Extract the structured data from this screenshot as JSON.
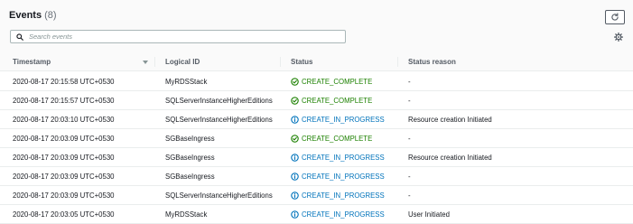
{
  "header": {
    "title": "Events",
    "count": "(8)"
  },
  "search": {
    "placeholder": "Search events",
    "value": ""
  },
  "columns": {
    "timestamp": "Timestamp",
    "logical_id": "Logical ID",
    "status": "Status",
    "status_reason": "Status reason"
  },
  "status_colors": {
    "CREATE_COMPLETE": "#1d8102",
    "CREATE_IN_PROGRESS": "#0073bb"
  },
  "events": [
    {
      "timestamp": "2020-08-17 20:15:58 UTC+0530",
      "logical_id": "MyRDSStack",
      "status": "CREATE_COMPLETE",
      "status_icon": "check-circle-icon",
      "reason": "-"
    },
    {
      "timestamp": "2020-08-17 20:15:57 UTC+0530",
      "logical_id": "SQLServerInstanceHigherEditions",
      "status": "CREATE_COMPLETE",
      "status_icon": "check-circle-icon",
      "reason": "-"
    },
    {
      "timestamp": "2020-08-17 20:03:10 UTC+0530",
      "logical_id": "SQLServerInstanceHigherEditions",
      "status": "CREATE_IN_PROGRESS",
      "status_icon": "info-circle-icon",
      "reason": "Resource creation Initiated"
    },
    {
      "timestamp": "2020-08-17 20:03:09 UTC+0530",
      "logical_id": "SGBaseIngress",
      "status": "CREATE_COMPLETE",
      "status_icon": "check-circle-icon",
      "reason": "-"
    },
    {
      "timestamp": "2020-08-17 20:03:09 UTC+0530",
      "logical_id": "SGBaseIngress",
      "status": "CREATE_IN_PROGRESS",
      "status_icon": "info-circle-icon",
      "reason": "Resource creation Initiated"
    },
    {
      "timestamp": "2020-08-17 20:03:09 UTC+0530",
      "logical_id": "SGBaseIngress",
      "status": "CREATE_IN_PROGRESS",
      "status_icon": "info-circle-icon",
      "reason": "-"
    },
    {
      "timestamp": "2020-08-17 20:03:09 UTC+0530",
      "logical_id": "SQLServerInstanceHigherEditions",
      "status": "CREATE_IN_PROGRESS",
      "status_icon": "info-circle-icon",
      "reason": "-"
    },
    {
      "timestamp": "2020-08-17 20:03:05 UTC+0530",
      "logical_id": "MyRDSStack",
      "status": "CREATE_IN_PROGRESS",
      "status_icon": "info-circle-icon",
      "reason": "User Initiated"
    }
  ]
}
